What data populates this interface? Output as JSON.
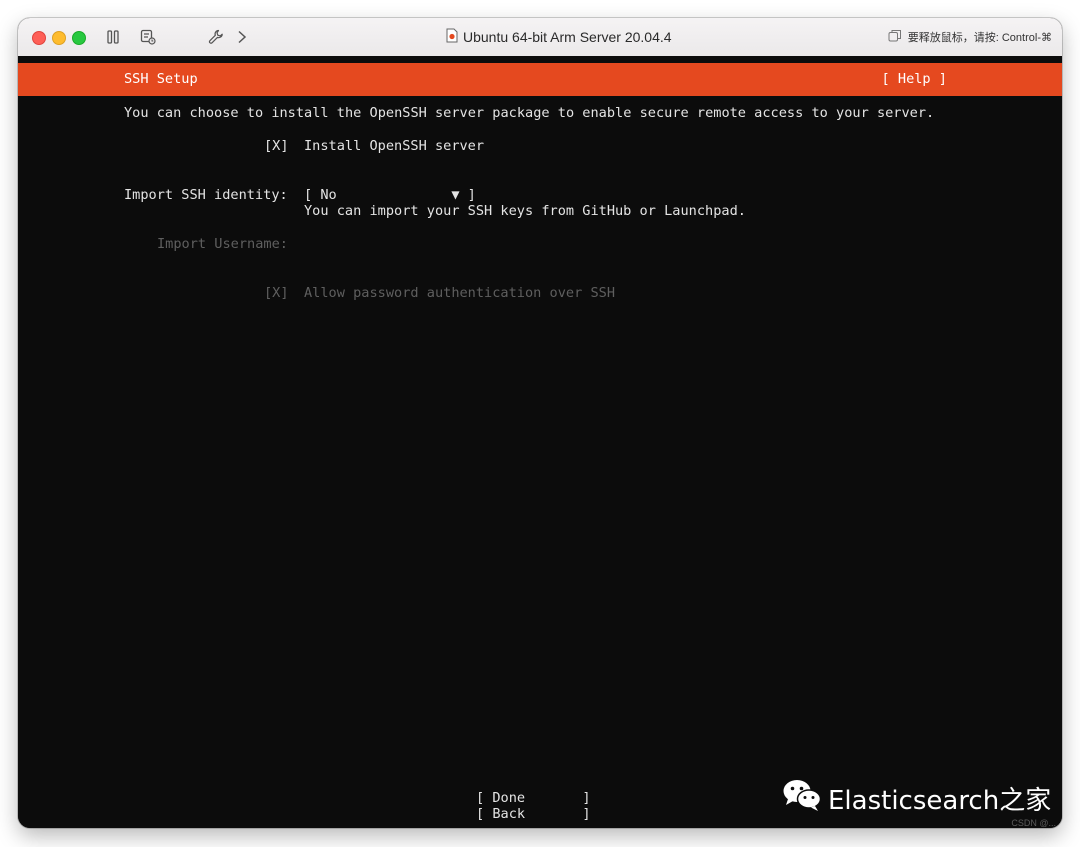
{
  "window": {
    "title": "Ubuntu 64-bit Arm Server 20.04.4",
    "release_hint": "要释放鼠标，请按: Control-⌘"
  },
  "installer": {
    "header_title": "SSH Setup",
    "help_button": "[ Help ]",
    "description": "You can choose to install the OpenSSH server package to enable secure remote access to your server.",
    "install_openssh": {
      "checkbox": "[X]",
      "label": "Install OpenSSH server"
    },
    "import_identity": {
      "label": "Import SSH identity:",
      "dropdown": "[ No              ▼ ]",
      "selected_value": "No",
      "help_text": "You can import your SSH keys from GitHub or Launchpad."
    },
    "import_username": {
      "label": "Import Username:",
      "value": ""
    },
    "allow_password": {
      "checkbox": "[X]",
      "label": "Allow password authentication over SSH"
    },
    "done_button": "[ Done       ]",
    "back_button": "[ Back       ]"
  },
  "watermark": {
    "text": "Elasticsearch之家",
    "corner_text": "CSDN @..."
  },
  "colors": {
    "header_bar": "#e5491f",
    "screen_bg": "#0c0c0c",
    "text": "#e4e4e4",
    "disabled_text": "#5f5f5f"
  }
}
